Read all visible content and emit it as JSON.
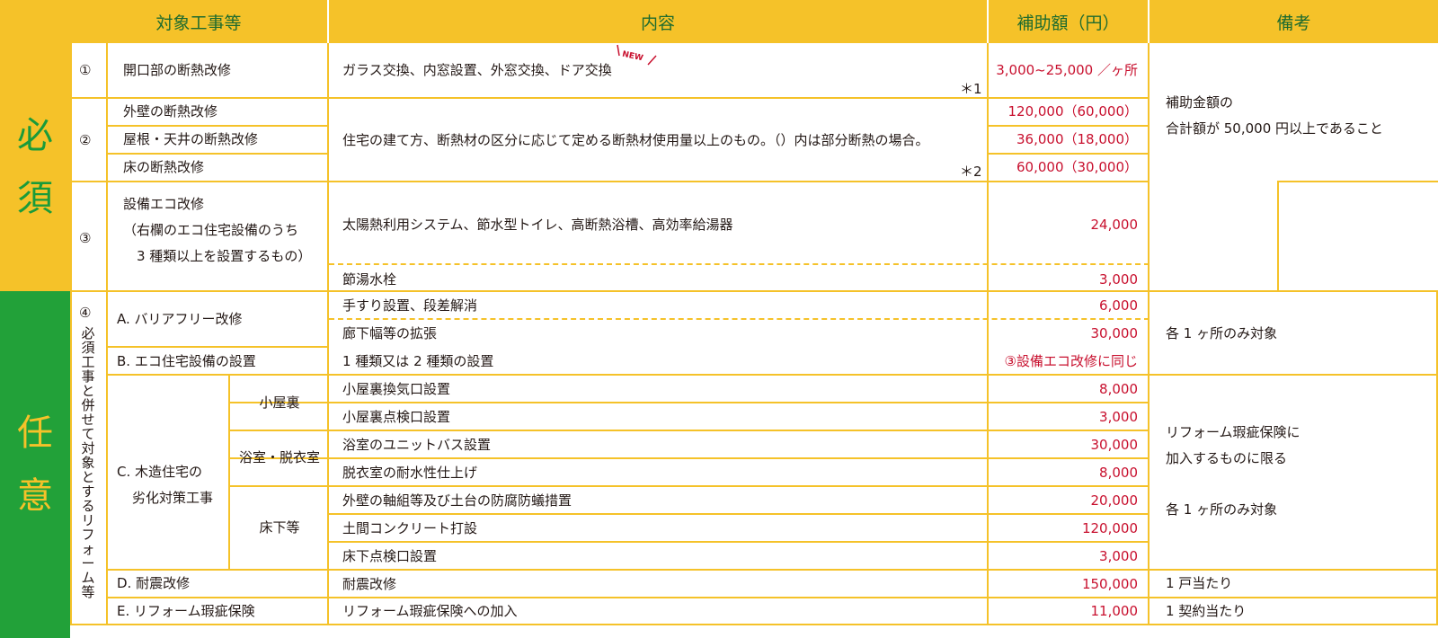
{
  "headers": {
    "target": "対象工事等",
    "content": "内容",
    "amount": "補助額（円）",
    "notes": "備考"
  },
  "sections": {
    "required": [
      "必",
      "須"
    ],
    "optional": [
      "任",
      "意"
    ]
  },
  "rows": {
    "r1": {
      "num": "①",
      "target": "開口部の断熱改修",
      "content": "ガラス交換、内窓設置、外窓交換、ドア交換",
      "new_badge": "NEW",
      "footnote": "＊1",
      "amount": "3,000~25,000 ／ヶ所"
    },
    "r2": {
      "num": "②",
      "targets": [
        "外壁の断熱改修",
        "屋根・天井の断熱改修",
        "床の断熱改修"
      ],
      "content": "住宅の建て方、断熱材の区分に応じて定める断熱材使用量以上のもの。（）内は部分断熱の場合。",
      "footnote": "＊2",
      "amounts": [
        "120,000（60,000）",
        "36,000（18,000）",
        "60,000（30,000）"
      ]
    },
    "r3": {
      "num": "③",
      "target_lines": [
        "設備エコ改修",
        "（右欄のエコ住宅設備のうち",
        "　3 種類以上を設置するもの）"
      ],
      "content_a": "太陽熱利用システム、節水型トイレ、高断熱浴槽、高効率給湯器",
      "amount_a": "24,000",
      "content_b": "節湯水栓",
      "amount_b": "3,000"
    },
    "required_note": [
      "補助金額の",
      "合計額が 50,000 円以上であること"
    ],
    "r4": {
      "num": "④",
      "vertical": [
        "必",
        "須",
        "工",
        "事",
        "と",
        "併",
        "せ",
        "て",
        "対",
        "象",
        "と",
        "す",
        "る",
        "リ",
        "フ",
        "ォ",
        "ー",
        "ム",
        "等"
      ],
      "a_target": "A. バリアフリー改修",
      "a_items": [
        {
          "content": "手すり設置、段差解消",
          "amount": "6,000"
        },
        {
          "content": "廊下幅等の拡張",
          "amount": "30,000"
        }
      ],
      "b_target": "B. エコ住宅設備の設置",
      "b_content": "1 種類又は 2 種類の設置",
      "b_amount": "③設備エコ改修に同じ",
      "ab_note": "各 1 ヶ所のみ対象",
      "c_target": [
        "C. 木造住宅の",
        "劣化対策工事"
      ],
      "c_groups": [
        {
          "label": "小屋裏",
          "items": [
            {
              "content": "小屋裏換気口設置",
              "amount": "8,000"
            },
            {
              "content": "小屋裏点検口設置",
              "amount": "3,000"
            }
          ]
        },
        {
          "label": "浴室・脱衣室",
          "items": [
            {
              "content": "浴室のユニットバス設置",
              "amount": "30,000"
            },
            {
              "content": "脱衣室の耐水性仕上げ",
              "amount": "8,000"
            }
          ]
        },
        {
          "label": "床下等",
          "items": [
            {
              "content": "外壁の軸組等及び土台の防腐防蟻措置",
              "amount": "20,000"
            },
            {
              "content": "土間コンクリート打設",
              "amount": "120,000"
            },
            {
              "content": "床下点検口設置",
              "amount": "3,000"
            }
          ]
        }
      ],
      "c_note": [
        "リフォーム瑕疵保険に",
        "加入するものに限る",
        "各 1 ヶ所のみ対象"
      ],
      "d_target": "D. 耐震改修",
      "d_content": "耐震改修",
      "d_amount": "150,000",
      "d_note": "1 戸当たり",
      "e_target": "E. リフォーム瑕疵保険",
      "e_content": "リフォーム瑕疵保険への加入",
      "e_amount": "11,000",
      "e_note": "1 契約当たり"
    }
  },
  "colors": {
    "header_bg": "#f5c229",
    "header_text": "#1e6b2e",
    "required_bg": "#f5c229",
    "required_text": "#1a9b3a",
    "optional_bg": "#22a139",
    "optional_text": "#f5c229",
    "amount_text": "#c8102e",
    "grid": "#f5c229"
  }
}
